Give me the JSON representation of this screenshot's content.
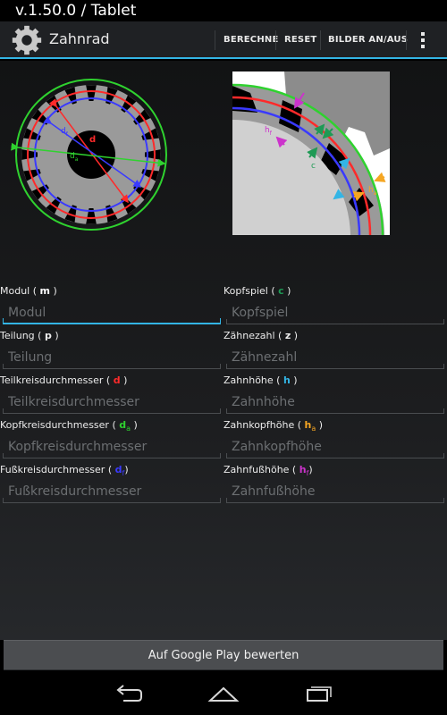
{
  "window": {
    "title": "v.1.50.0 / Tablet"
  },
  "actionbar": {
    "app_icon": "gear-icon",
    "app_title": "Zahnrad",
    "buttons": [
      "BERECHNE",
      "RESET",
      "BILDER AN/AUS"
    ],
    "overflow_icon": "overflow-menu-icon"
  },
  "diagram_left": {
    "labels": {
      "df": "d",
      "df_sub": "f",
      "d": "d",
      "da": "d",
      "da_sub": "a"
    }
  },
  "diagram_right": {
    "labels": {
      "hf": "h",
      "hf_sub": "f",
      "c": "c",
      "ha": "h",
      "ha_sub": "a"
    }
  },
  "fields_left": [
    {
      "label": "Modul",
      "symbol": "m",
      "sub": "",
      "color": "#ffffff",
      "placeholder": "Modul"
    },
    {
      "label": "Teilung",
      "symbol": "p",
      "sub": "",
      "color": "#ffffff",
      "placeholder": "Teilung"
    },
    {
      "label": "Teilkreisdurchmesser",
      "symbol": "d",
      "sub": "",
      "color": "#ff2a2a",
      "placeholder": "Teilkreisdurchmesser"
    },
    {
      "label": "Kopfkreisdurchmesser",
      "symbol": "d",
      "sub": "a",
      "color": "#2fd22f",
      "placeholder": "Kopfkreisdurchmesser"
    },
    {
      "label": "Fußkreisdurchmesser",
      "symbol": "d",
      "sub": "f",
      "color": "#3a3aff",
      "placeholder": "Fußkreisdurchmesser"
    }
  ],
  "fields_right": [
    {
      "label": "Kopfspiel",
      "symbol": "c",
      "sub": "",
      "color": "#1f9a55",
      "placeholder": "Kopfspiel"
    },
    {
      "label": "Zähnezahl",
      "symbol": "z",
      "sub": "",
      "color": "#ffffff",
      "placeholder": "Zähnezahl"
    },
    {
      "label": "Zahnhöhe",
      "symbol": "h",
      "sub": "",
      "color": "#33b5e5",
      "placeholder": "Zahnhöhe"
    },
    {
      "label": "Zahnkopfhöhe",
      "symbol": "h",
      "sub": "a",
      "color": "#f5a623",
      "placeholder": "Zahnkopfhöhe"
    },
    {
      "label": "Zahnfußhöhe",
      "symbol": "h",
      "sub": "f",
      "color": "#cc33cc",
      "placeholder": "Zahnfußhöhe"
    }
  ],
  "rate_button": "Auf Google Play bewerten",
  "navbar": {
    "back": "back-icon",
    "home": "home-icon",
    "recents": "recents-icon"
  },
  "colors": {
    "accent": "#33b5e5",
    "pitch_circle": "#ff2a2a",
    "tip_circle": "#2fd22f",
    "root_circle": "#3a3aff"
  }
}
